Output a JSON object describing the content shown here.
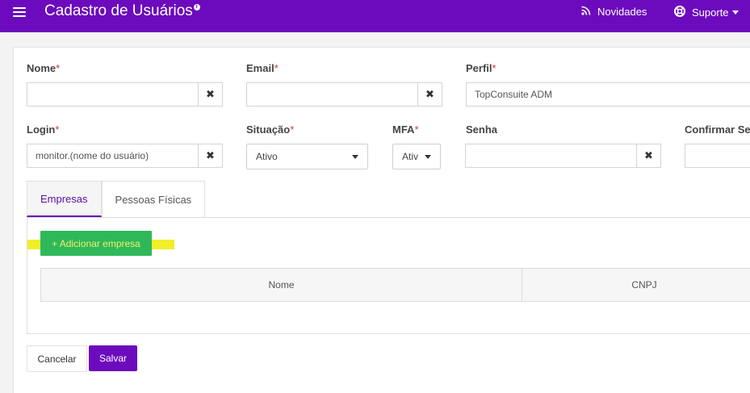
{
  "header": {
    "title": "Cadastro de Usuários",
    "info_icon": "i",
    "novidades": "Novidades",
    "suporte": "Suporte"
  },
  "form": {
    "nome_label": "Nome",
    "email_label": "Email",
    "perfil_label": "Perfil",
    "perfil_value": "TopConsuite ADM",
    "login_label": "Login",
    "login_value": "monitor.(nome do usuário)",
    "situacao_label": "Situação",
    "situacao_value": "Ativo",
    "mfa_label": "MFA",
    "mfa_value": "Ativ",
    "senha_label": "Senha",
    "confirmar_label": "Confirmar Ser",
    "required_mark": "*",
    "clear_glyph": "✖"
  },
  "tabs": [
    {
      "label": "Empresas"
    },
    {
      "label": "Pessoas Físicas"
    }
  ],
  "empresas": {
    "add_button": "+ Adicionar empresa",
    "columns": [
      "Nome",
      "CNPJ"
    ]
  },
  "actions": {
    "cancel": "Cancelar",
    "save": "Salvar"
  },
  "colors": {
    "brand": "#6c0bbd",
    "add_button": "#2fb85a",
    "highlight": "#f0ef2a",
    "required": "#c83737"
  }
}
